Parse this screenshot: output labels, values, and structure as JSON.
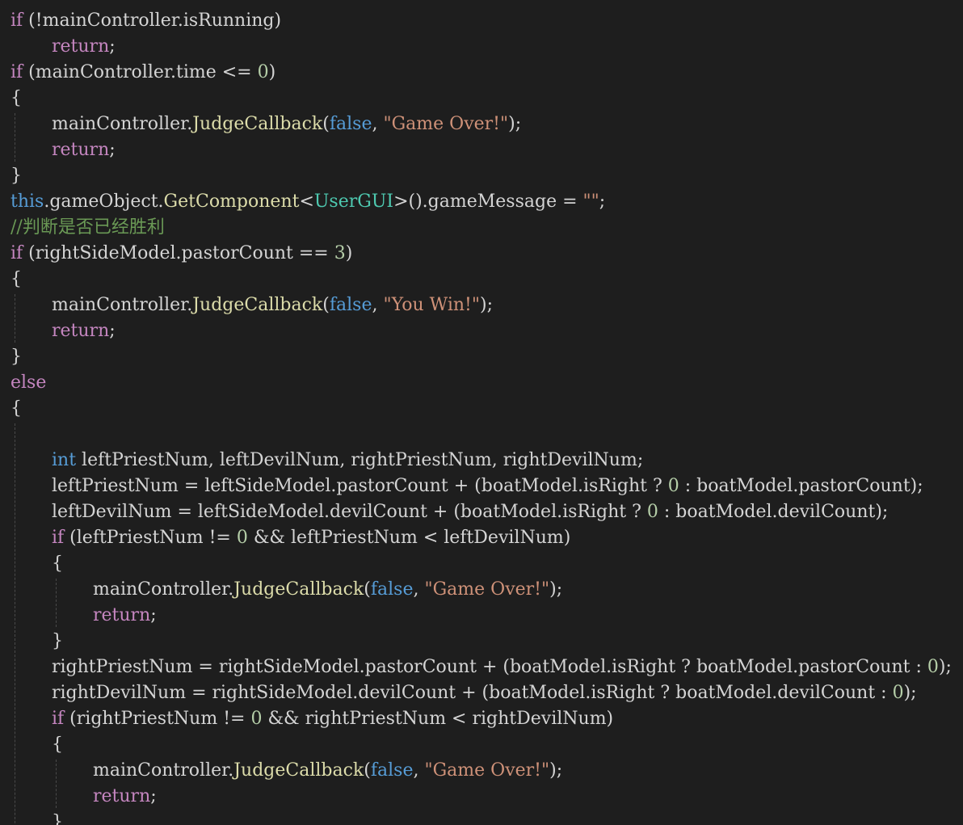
{
  "editor": {
    "colors": {
      "background": "#1e1e1e",
      "default": "#d4d4d4",
      "control_keyword": "#c586c0",
      "keyword": "#569cd6",
      "function": "#dcdcaa",
      "type": "#4ec9b0",
      "string": "#ce9178",
      "number": "#b5cea8",
      "comment": "#6a9955"
    },
    "lines": [
      {
        "indent": 0,
        "tokens": [
          {
            "t": "if",
            "k": "kw"
          },
          {
            "t": " (!mainController.isRunning)",
            "k": "txt"
          }
        ]
      },
      {
        "indent": 1,
        "tokens": [
          {
            "t": "return",
            "k": "kw"
          },
          {
            "t": ";",
            "k": "txt"
          }
        ]
      },
      {
        "indent": 0,
        "tokens": [
          {
            "t": "if",
            "k": "kw"
          },
          {
            "t": " (mainController.time <= ",
            "k": "txt"
          },
          {
            "t": "0",
            "k": "num"
          },
          {
            "t": ")",
            "k": "txt"
          }
        ]
      },
      {
        "indent": 0,
        "tokens": [
          {
            "t": "{",
            "k": "txt"
          }
        ]
      },
      {
        "indent": 1,
        "tokens": [
          {
            "t": "mainController.",
            "k": "txt"
          },
          {
            "t": "JudgeCallback",
            "k": "fn"
          },
          {
            "t": "(",
            "k": "txt"
          },
          {
            "t": "false",
            "k": "kb"
          },
          {
            "t": ", ",
            "k": "txt"
          },
          {
            "t": "\"Game Over!\"",
            "k": "str"
          },
          {
            "t": ");",
            "k": "txt"
          }
        ]
      },
      {
        "indent": 1,
        "tokens": [
          {
            "t": "return",
            "k": "kw"
          },
          {
            "t": ";",
            "k": "txt"
          }
        ]
      },
      {
        "indent": 0,
        "tokens": [
          {
            "t": "}",
            "k": "txt"
          }
        ]
      },
      {
        "indent": 0,
        "tokens": [
          {
            "t": "this",
            "k": "kb"
          },
          {
            "t": ".gameObject.",
            "k": "txt"
          },
          {
            "t": "GetComponent",
            "k": "fn"
          },
          {
            "t": "<",
            "k": "txt"
          },
          {
            "t": "UserGUI",
            "k": "type"
          },
          {
            "t": ">().gameMessage = ",
            "k": "txt"
          },
          {
            "t": "\"\"",
            "k": "str"
          },
          {
            "t": ";",
            "k": "txt"
          }
        ]
      },
      {
        "indent": 0,
        "tokens": [
          {
            "t": "//判断是否已经胜利",
            "k": "com"
          }
        ]
      },
      {
        "indent": 0,
        "tokens": [
          {
            "t": "if",
            "k": "kw"
          },
          {
            "t": " (rightSideModel.pastorCount == ",
            "k": "txt"
          },
          {
            "t": "3",
            "k": "num"
          },
          {
            "t": ")",
            "k": "txt"
          }
        ]
      },
      {
        "indent": 0,
        "tokens": [
          {
            "t": "{",
            "k": "txt"
          }
        ]
      },
      {
        "indent": 1,
        "tokens": [
          {
            "t": "mainController.",
            "k": "txt"
          },
          {
            "t": "JudgeCallback",
            "k": "fn"
          },
          {
            "t": "(",
            "k": "txt"
          },
          {
            "t": "false",
            "k": "kb"
          },
          {
            "t": ", ",
            "k": "txt"
          },
          {
            "t": "\"You Win!\"",
            "k": "str"
          },
          {
            "t": ");",
            "k": "txt"
          }
        ]
      },
      {
        "indent": 1,
        "tokens": [
          {
            "t": "return",
            "k": "kw"
          },
          {
            "t": ";",
            "k": "txt"
          }
        ]
      },
      {
        "indent": 0,
        "tokens": [
          {
            "t": "}",
            "k": "txt"
          }
        ]
      },
      {
        "indent": 0,
        "tokens": [
          {
            "t": "else",
            "k": "kw"
          }
        ]
      },
      {
        "indent": 0,
        "tokens": [
          {
            "t": "{",
            "k": "txt"
          }
        ]
      },
      {
        "indent": 0,
        "tokens": []
      },
      {
        "indent": 1,
        "tokens": [
          {
            "t": "int",
            "k": "kb"
          },
          {
            "t": " leftPriestNum, leftDevilNum, rightPriestNum, rightDevilNum;",
            "k": "txt"
          }
        ]
      },
      {
        "indent": 1,
        "tokens": [
          {
            "t": "leftPriestNum = leftSideModel.pastorCount + (boatModel.isRight ? ",
            "k": "txt"
          },
          {
            "t": "0",
            "k": "num"
          },
          {
            "t": " : boatModel.pastorCount);",
            "k": "txt"
          }
        ]
      },
      {
        "indent": 1,
        "tokens": [
          {
            "t": "leftDevilNum = leftSideModel.devilCount + (boatModel.isRight ? ",
            "k": "txt"
          },
          {
            "t": "0",
            "k": "num"
          },
          {
            "t": " : boatModel.devilCount);",
            "k": "txt"
          }
        ]
      },
      {
        "indent": 1,
        "tokens": [
          {
            "t": "if",
            "k": "kw"
          },
          {
            "t": " (leftPriestNum != ",
            "k": "txt"
          },
          {
            "t": "0",
            "k": "num"
          },
          {
            "t": " && leftPriestNum < leftDevilNum)",
            "k": "txt"
          }
        ]
      },
      {
        "indent": 1,
        "tokens": [
          {
            "t": "{",
            "k": "txt"
          }
        ]
      },
      {
        "indent": 2,
        "tokens": [
          {
            "t": "mainController.",
            "k": "txt"
          },
          {
            "t": "JudgeCallback",
            "k": "fn"
          },
          {
            "t": "(",
            "k": "txt"
          },
          {
            "t": "false",
            "k": "kb"
          },
          {
            "t": ", ",
            "k": "txt"
          },
          {
            "t": "\"Game Over!\"",
            "k": "str"
          },
          {
            "t": ");",
            "k": "txt"
          }
        ]
      },
      {
        "indent": 2,
        "tokens": [
          {
            "t": "return",
            "k": "kw"
          },
          {
            "t": ";",
            "k": "txt"
          }
        ]
      },
      {
        "indent": 1,
        "tokens": [
          {
            "t": "}",
            "k": "txt"
          }
        ]
      },
      {
        "indent": 1,
        "tokens": [
          {
            "t": "rightPriestNum = rightSideModel.pastorCount + (boatModel.isRight ? boatModel.pastorCount : ",
            "k": "txt"
          },
          {
            "t": "0",
            "k": "num"
          },
          {
            "t": ");",
            "k": "txt"
          }
        ]
      },
      {
        "indent": 1,
        "tokens": [
          {
            "t": "rightDevilNum = rightSideModel.devilCount + (boatModel.isRight ? boatModel.devilCount : ",
            "k": "txt"
          },
          {
            "t": "0",
            "k": "num"
          },
          {
            "t": ");",
            "k": "txt"
          }
        ]
      },
      {
        "indent": 1,
        "tokens": [
          {
            "t": "if",
            "k": "kw"
          },
          {
            "t": " (rightPriestNum != ",
            "k": "txt"
          },
          {
            "t": "0",
            "k": "num"
          },
          {
            "t": " && rightPriestNum < rightDevilNum)",
            "k": "txt"
          }
        ]
      },
      {
        "indent": 1,
        "tokens": [
          {
            "t": "{",
            "k": "txt"
          }
        ]
      },
      {
        "indent": 2,
        "tokens": [
          {
            "t": "mainController.",
            "k": "txt"
          },
          {
            "t": "JudgeCallback",
            "k": "fn"
          },
          {
            "t": "(",
            "k": "txt"
          },
          {
            "t": "false",
            "k": "kb"
          },
          {
            "t": ", ",
            "k": "txt"
          },
          {
            "t": "\"Game Over!\"",
            "k": "str"
          },
          {
            "t": ");",
            "k": "txt"
          }
        ]
      },
      {
        "indent": 2,
        "tokens": [
          {
            "t": "return",
            "k": "kw"
          },
          {
            "t": ";",
            "k": "txt"
          }
        ]
      },
      {
        "indent": 1,
        "tokens": [
          {
            "t": "}",
            "k": "txt"
          }
        ]
      }
    ]
  }
}
